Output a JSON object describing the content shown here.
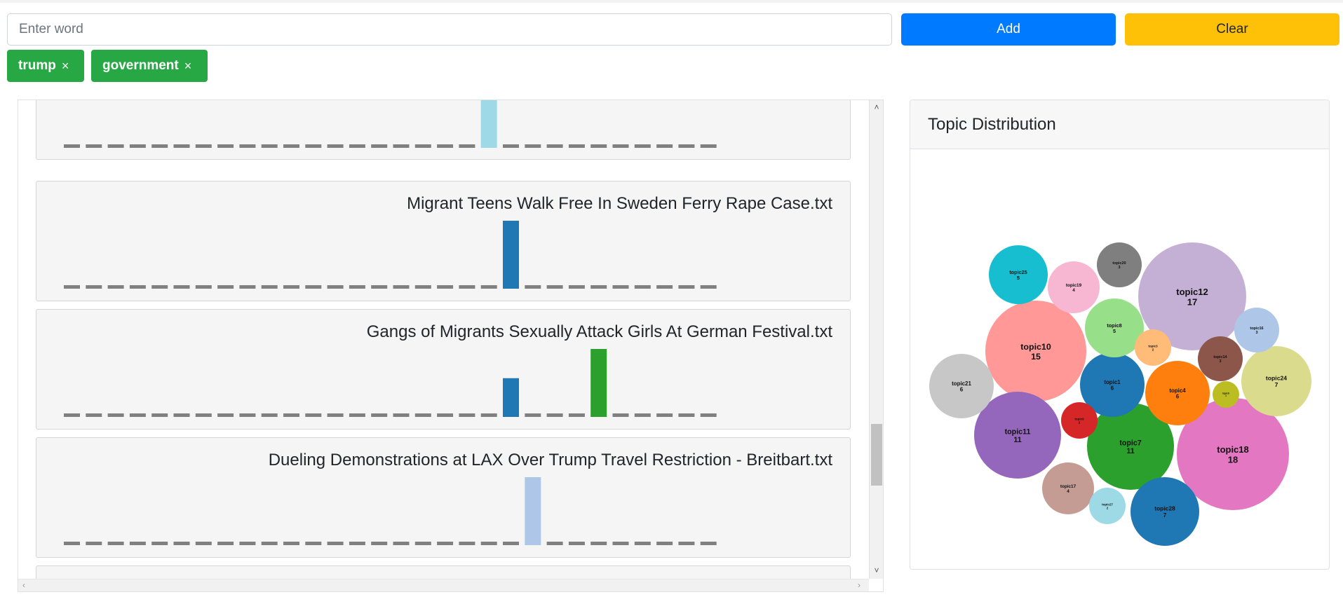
{
  "search": {
    "placeholder": "Enter word",
    "value": ""
  },
  "buttons": {
    "add_label": "Add",
    "clear_label": "Clear"
  },
  "colors": {
    "add": "#007bff",
    "clear": "#ffc107",
    "chip": "#28a745"
  },
  "filter_words": [
    {
      "label": "trump",
      "remove": "×"
    },
    {
      "label": "government",
      "remove": "×"
    }
  ],
  "documents": [
    {
      "title": "",
      "bars": [
        {
          "index": 19,
          "value": 1.0,
          "color": "#9edae5"
        }
      ]
    },
    {
      "title": "Migrant Teens Walk Free In Sweden Ferry Rape Case.txt",
      "bars": [
        {
          "index": 20,
          "value": 1.0,
          "color": "#1f77b4"
        }
      ]
    },
    {
      "title": "Gangs of Migrants Sexually Attack Girls At German Festival.txt",
      "bars": [
        {
          "index": 20,
          "value": 0.57,
          "color": "#1f77b4"
        },
        {
          "index": 24,
          "value": 1.0,
          "color": "#2ca02c"
        }
      ]
    },
    {
      "title": "Dueling Demonstrations at LAX Over Trump Travel Restriction - Breitbart.txt",
      "bars": [
        {
          "index": 21,
          "value": 1.0,
          "color": "#aec7e8"
        }
      ]
    }
  ],
  "topic_panel": {
    "title": "Topic Distribution"
  },
  "chart_data": {
    "type": "bubble",
    "topics": [
      {
        "name": "topic12",
        "count": 17,
        "color": "#c5b0d5"
      },
      {
        "name": "topic18",
        "count": 18,
        "color": "#e377c2"
      },
      {
        "name": "topic10",
        "count": 15,
        "color": "#ff9896"
      },
      {
        "name": "topic7",
        "count": 11,
        "color": "#2ca02c"
      },
      {
        "name": "topic11",
        "count": 11,
        "color": "#9467bd"
      },
      {
        "name": "topic28",
        "count": 7,
        "color": "#1f77b4"
      },
      {
        "name": "topic24",
        "count": 7,
        "color": "#dbdb8d"
      },
      {
        "name": "topic21",
        "count": 6,
        "color": "#c7c7c7"
      },
      {
        "name": "topic1",
        "count": 6,
        "color": "#1f77b4"
      },
      {
        "name": "topic4",
        "count": 6,
        "color": "#ff7f0e"
      },
      {
        "name": "topic25",
        "count": 5,
        "color": "#17becf"
      },
      {
        "name": "topic8",
        "count": 5,
        "color": "#98df8a"
      },
      {
        "name": "topic19",
        "count": 4,
        "color": "#f7b6d2"
      },
      {
        "name": "topic17",
        "count": 4,
        "color": "#c49c94"
      },
      {
        "name": "topic20",
        "count": 3,
        "color": "#7f7f7f"
      },
      {
        "name": "topic16",
        "count": 3,
        "color": "#aec7e8"
      },
      {
        "name": "topic14",
        "count": 3,
        "color": "#8c564b"
      },
      {
        "name": "topic3",
        "count": 2,
        "color": "#ffbb78"
      },
      {
        "name": "topic9",
        "count": 2,
        "color": "#d62728"
      },
      {
        "name": "topic27",
        "count": 2,
        "color": "#9edae5"
      },
      {
        "name": "topic6",
        "count": 1,
        "color": "#bcbd22"
      }
    ]
  }
}
